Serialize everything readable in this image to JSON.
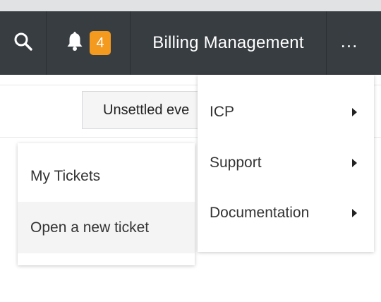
{
  "navbar": {
    "search_icon": "search-icon",
    "bell_icon": "bell-icon",
    "notification_count": "4",
    "title": "Billing Management",
    "more_label": "..."
  },
  "subbar": {
    "filter_button_label": "Unsettled eve"
  },
  "tickets_menu": {
    "items": [
      {
        "label": "My Tickets"
      },
      {
        "label": "Open a new ticket"
      }
    ]
  },
  "more_menu": {
    "items": [
      {
        "label": "ICP",
        "icon": "caret-right-icon"
      },
      {
        "label": "Support",
        "icon": "caret-right-icon"
      },
      {
        "label": "Documentation",
        "icon": "caret-right-icon"
      }
    ]
  },
  "colors": {
    "navbar_bg": "#373d41",
    "badge_bg": "#f39a1f",
    "hover_bg": "#f4f4f4"
  }
}
